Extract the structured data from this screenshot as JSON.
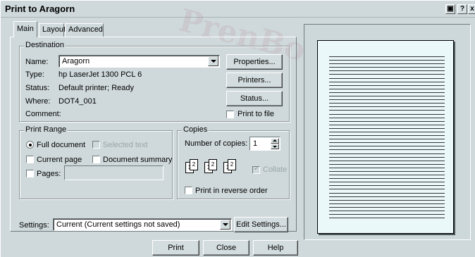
{
  "window": {
    "title": "Print to Aragorn"
  },
  "titlebar_buttons": {
    "restore": "▣",
    "help": "?",
    "close": "x"
  },
  "tabs": [
    {
      "label": "Main"
    },
    {
      "label": "Layout"
    },
    {
      "label": "Advanced"
    }
  ],
  "watermark": "PrenBooks",
  "destination": {
    "group_label": "Destination",
    "name_label": "Name:",
    "name_value": "Aragorn",
    "type_label": "Type:",
    "type_value": "hp LaserJet 1300 PCL 6",
    "status_label": "Status:",
    "status_value": "Default printer; Ready",
    "where_label": "Where:",
    "where_value": "DOT4_001",
    "comment_label": "Comment:",
    "properties_button": "Properties...",
    "printers_button": "Printers...",
    "status_button": "Status...",
    "print_to_file": "Print to file"
  },
  "print_range": {
    "group_label": "Print Range",
    "full_document": "Full document",
    "selected_text": "Selected text",
    "current_page": "Current page",
    "document_summary": "Document summary",
    "pages": "Pages:"
  },
  "copies": {
    "group_label": "Copies",
    "number_label": "Number of copies:",
    "number_value": "1",
    "collate": "Collate",
    "reverse_order": "Print in reverse order"
  },
  "settings": {
    "label": "Settings:",
    "value": "Current (Current settings not saved)",
    "edit_button": "Edit Settings..."
  },
  "footer": {
    "print_button": "Print",
    "close_button": "Close",
    "help_button": "Help"
  }
}
